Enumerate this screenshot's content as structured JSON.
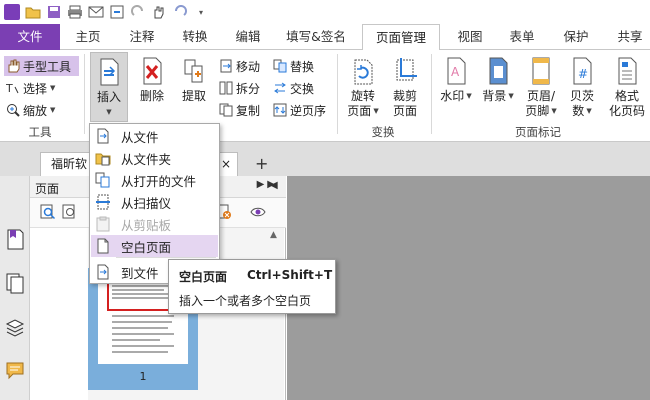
{
  "ribbon_tabs": [
    "文件",
    "主页",
    "注释",
    "转换",
    "编辑",
    "填写&签名",
    "页面管理",
    "视图",
    "表单",
    "保护",
    "共享"
  ],
  "active_tab": "页面管理",
  "tools_group": {
    "hand": "手型工具",
    "select": "选择",
    "zoom": "缩放",
    "label": "工具"
  },
  "page_group": {
    "insert": "插入",
    "delete": "删除",
    "extract": "提取",
    "move": "移动",
    "split": "拆分",
    "copy": "复制",
    "replace": "替换",
    "swap": "交换",
    "reverse": "逆页序"
  },
  "transform_group": {
    "rotate_l1": "旋转",
    "rotate_l2": "页面",
    "crop_l1": "裁剪",
    "crop_l2": "页面",
    "label": "变换"
  },
  "marks_group": {
    "watermark": "水印",
    "background": "背景",
    "header_l1": "页眉/",
    "header_l2": "页脚",
    "bates_l1": "贝茨",
    "bates_l2": "数",
    "format_l1": "格式",
    "format_l2": "化页码",
    "label": "页面标记"
  },
  "document": {
    "tab_title": "福昕软",
    "close": "×",
    "new_tab": "+"
  },
  "page_panel": {
    "title": "页面",
    "page_number": "1"
  },
  "insert_menu": {
    "items": [
      "从文件",
      "从文件夹",
      "从打开的文件",
      "从扫描仪",
      "从剪贴板",
      "空白页面"
    ],
    "to_file": "到文件"
  },
  "tooltip": {
    "title": "空白页面",
    "shortcut": "Ctrl+Shift+T",
    "description": "插入一个或者多个空白页"
  },
  "colors": {
    "brand": "#7b3fb3",
    "highlight": "#e5d6f1",
    "selection": "#d7c2ea",
    "thumb_selected": "#7aaedb",
    "page_border_red": "#d42020"
  }
}
